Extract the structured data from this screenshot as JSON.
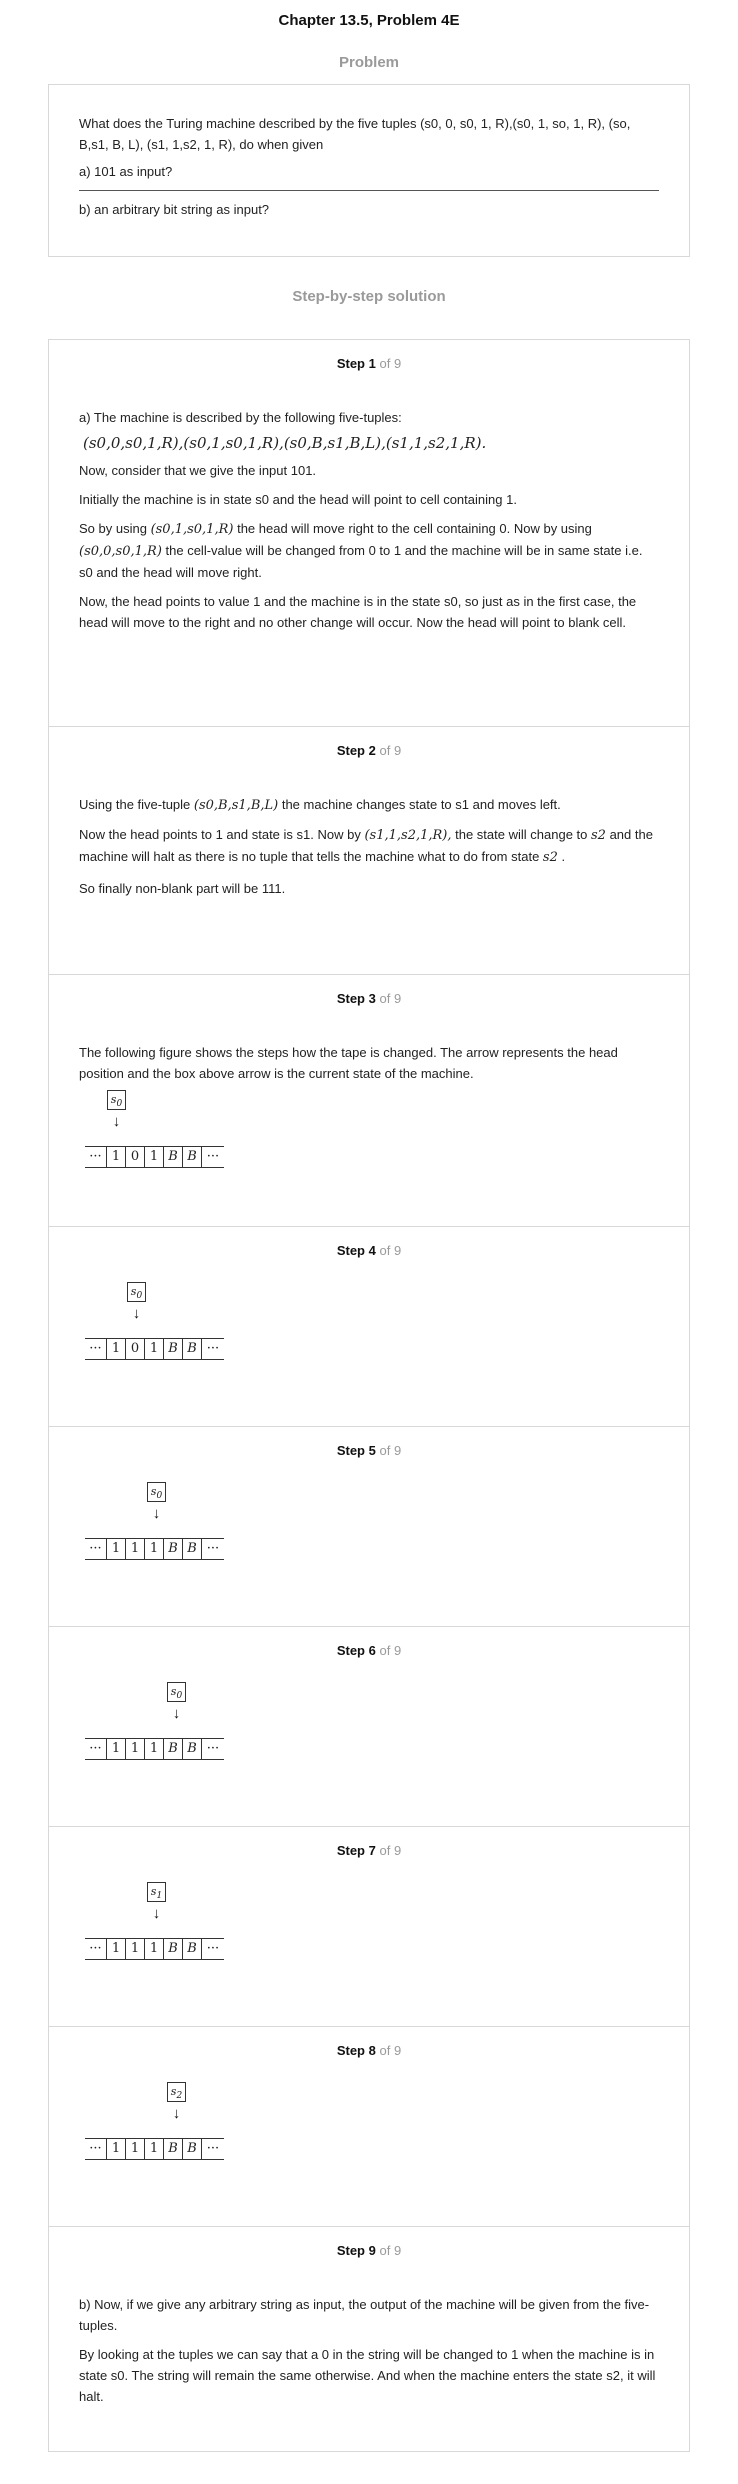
{
  "header": {
    "title": "Chapter 13.5, Problem 4E"
  },
  "problem": {
    "section_label": "Problem",
    "question": "What does the Turing machine described by the five tuples (s0, 0, s0, 1, R),(s0, 1, so, 1, R), (so, B,s1, B, L), (s1, 1,s2, 1, R), do when given",
    "part_a": "a) 101 as input?",
    "part_b": "b) an arbitrary bit string as input?"
  },
  "solution": {
    "section_label": "Step-by-step solution",
    "of_label": "of 9",
    "step_word": "Step",
    "steps": [
      {
        "num": "1",
        "intro": "a) The machine is described by the following five-tuples:",
        "tuples": "(s0,0,s0,1,R),(s0,1,s0,1,R),(s0,B,s1,B,L),(s1,1,s2,1,R).",
        "p1": "Now, consider that we give the input 101.",
        "p2": "Initially the machine is in state s0 and the head will point to cell containing 1.",
        "p3a": "So by using",
        "p3_math1": "(s0,1,s0,1,R)",
        "p3b": "the head will move right to the cell containing 0. Now by using",
        "p3_math2": "(s0,0,s0,1,R)",
        "p3c": "the cell-value will be changed from 0 to 1 and the machine will be in same state i.e. s0 and the head will move right.",
        "p4": "Now, the head points to value 1 and the machine is in the state s0, so just as in the first case, the head will move to the right and no other change will occur. Now the head will point to blank cell."
      },
      {
        "num": "2",
        "p1a": "Using the five-tuple",
        "p1_math": "(s0,B,s1,B,L)",
        "p1b": "the machine changes state to s1 and moves left.",
        "p2a": "Now the head points to 1 and state is s1. Now by",
        "p2_math": "(s1,1,s2,1,R),",
        "p2b": "the state will change to",
        "p2_math2": "s2",
        "p2c": "and the machine will halt as there is no tuple that tells the machine what to do from state",
        "p2_math3": "s2",
        "p2d": ".",
        "p3": "So finally non-blank part will be 111."
      },
      {
        "num": "3",
        "p1": "The following figure shows the steps how the tape is changed. The arrow represents the head position and the box above arrow is the current state of the machine.",
        "tape": [
          "···",
          "1",
          "0",
          "1",
          "B",
          "B",
          "···"
        ],
        "state": "s0",
        "head_cell": 1
      },
      {
        "num": "4",
        "tape": [
          "···",
          "1",
          "0",
          "1",
          "B",
          "B",
          "···"
        ],
        "state": "s0",
        "head_cell": 2
      },
      {
        "num": "5",
        "tape": [
          "···",
          "1",
          "1",
          "1",
          "B",
          "B",
          "···"
        ],
        "state": "s0",
        "head_cell": 3
      },
      {
        "num": "6",
        "tape": [
          "···",
          "1",
          "1",
          "1",
          "B",
          "B",
          "···"
        ],
        "state": "s0",
        "head_cell": 4
      },
      {
        "num": "7",
        "tape": [
          "···",
          "1",
          "1",
          "1",
          "B",
          "B",
          "···"
        ],
        "state": "s1",
        "head_cell": 3
      },
      {
        "num": "8",
        "tape": [
          "···",
          "1",
          "1",
          "1",
          "B",
          "B",
          "···"
        ],
        "state": "s2",
        "head_cell": 4
      },
      {
        "num": "9",
        "p1": "b) Now, if we give any arbitrary string as input, the output of the machine will be given from the five-tuples.",
        "p2": "By looking at the tuples we can say that a 0 in the string will be changed to 1 when the machine is in state s0. The string will remain the same otherwise. And when the machine enters the state s2, it will halt."
      }
    ]
  }
}
